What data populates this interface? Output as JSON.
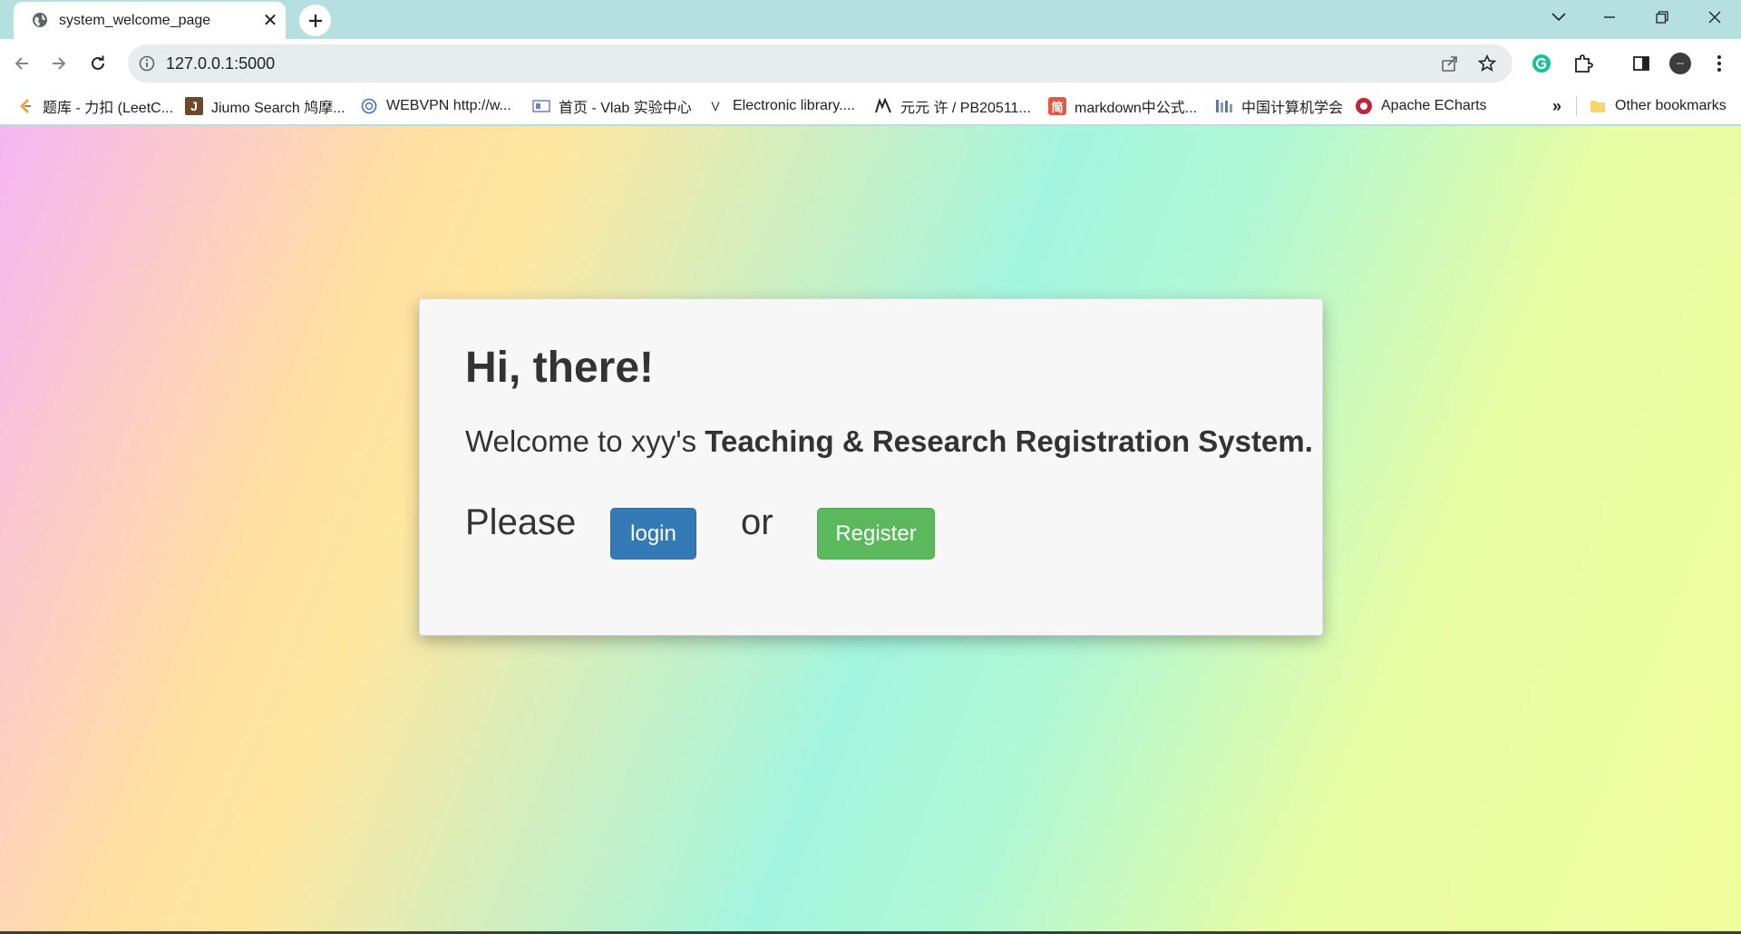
{
  "browser": {
    "tab": {
      "title": "system_welcome_page"
    },
    "address_bar": {
      "url": "127.0.0.1:5000"
    },
    "bookmarks": [
      {
        "label": "题库 - 力扣 (LeetC...",
        "icon": "leetcode-icon",
        "color": "#f0a020"
      },
      {
        "label": "Jiumo Search 鸠摩...",
        "icon": "jiumo-icon",
        "color": "#6b4a2a"
      },
      {
        "label": "WEBVPN http://w...",
        "icon": "webvpn-icon",
        "color": "#3a6fd8"
      },
      {
        "label": "首页 - Vlab 实验中心",
        "icon": "vlab-icon",
        "color": "#7080c0"
      },
      {
        "label": "Electronic library....",
        "icon": "electronic-library-icon",
        "color": "#333333"
      },
      {
        "label": "元元 许 / PB20511...",
        "icon": "gitlab-icon",
        "color": "#222222"
      },
      {
        "label": "markdown中公式...",
        "icon": "jianshu-icon",
        "color": "#e05a44"
      },
      {
        "label": "中国计算机学会",
        "icon": "ccf-icon",
        "color": "#5577aa"
      },
      {
        "label": "Apache ECharts",
        "icon": "echarts-icon",
        "color": "#c0243a"
      }
    ],
    "overflow_label": "»",
    "other_bookmarks": "Other bookmarks"
  },
  "card": {
    "heading": "Hi, there!",
    "welcome_prefix": "Welcome to xyy's ",
    "welcome_bold": "Teaching & Research Registration System.",
    "please": "Please",
    "login_label": "login",
    "or": "or",
    "register_label": "Register"
  },
  "colors": {
    "login_button": "#337ab7",
    "register_button": "#5cb85c",
    "chrome_frame": "#b6dfe0"
  }
}
